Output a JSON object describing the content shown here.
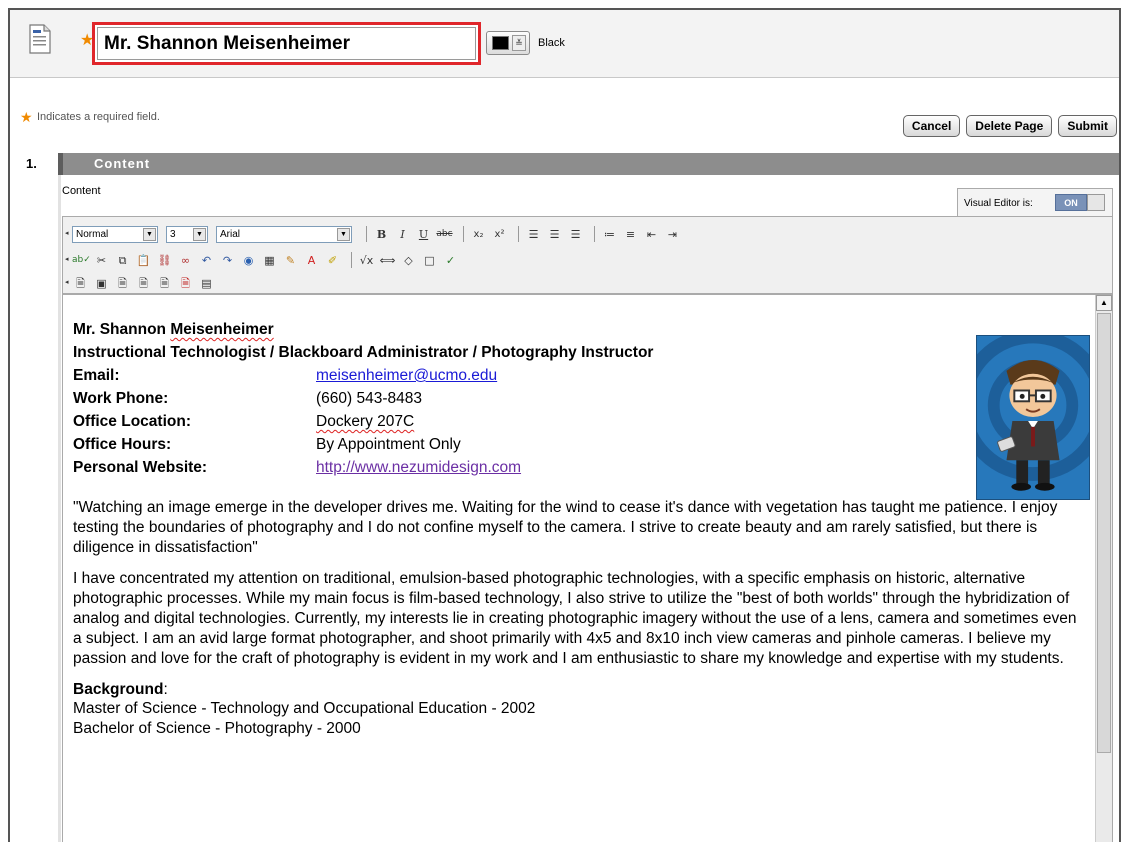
{
  "header": {
    "title_value": "Mr. Shannon Meisenheimer",
    "color_label": "Black",
    "color_value": "#000000"
  },
  "form": {
    "required_note": "Indicates a required field.",
    "buttons": {
      "cancel": "Cancel",
      "delete": "Delete Page",
      "submit": "Submit"
    }
  },
  "section": {
    "number": "1.",
    "title": "Content",
    "content_label": "Content"
  },
  "visual_editor": {
    "label": "Visual Editor is:",
    "state": "ON"
  },
  "toolbar": {
    "format": "Normal",
    "size": "3",
    "font": "Arial"
  },
  "document": {
    "name_first": "Mr. Shannon ",
    "name_last": "Meisenheimer",
    "position": "Instructional Technologist / Blackboard Administrator / Photography Instructor",
    "info": [
      {
        "label": "Email:",
        "value": "meisenheimer@ucmo.edu"
      },
      {
        "label": "Work Phone:",
        "value": "(660) 543-8483"
      },
      {
        "label": "Office Location:",
        "value": "Dockery 207C"
      },
      {
        "label": "Office Hours:",
        "value": "By Appointment Only"
      },
      {
        "label": "Personal Website:",
        "value": "http://www.nezumidesign.com"
      }
    ],
    "quote": "\"Watching an image emerge in the developer drives me. Waiting for the wind to cease it's dance with vegetation has taught me patience. I enjoy testing the boundaries of photography and I do not confine myself to the camera. I strive to create beauty and am rarely satisfied, but there is diligence in dissatisfaction\"",
    "bio": "I have concentrated my attention on traditional, emulsion-based photographic technologies, with a specific emphasis on historic, alternative photographic processes. While my main focus is film-based technology, I also strive to utilize the \"best of both worlds\" through the hybridization of analog and digital technologies. Currently, my interests lie in creating photographic imagery without the use of a lens, camera and sometimes even a subject. I am an avid large format photographer, and shoot primarily with 4x5 and 8x10 inch view cameras and pinhole cameras. I believe my passion and love for the craft of photography is evident in my work and I am enthusiastic to share my knowledge and expertise with my students.",
    "background_title": "Background",
    "background_colon": ":",
    "background": [
      "Master of Science - Technology and Occupational Education - 2002",
      "Bachelor of Science - Photography - 2000"
    ]
  },
  "colors": {
    "required_star": "#f08a00",
    "highlight_border": "#e0262b",
    "section_bar": "#8d8d8d",
    "link": "#1a1ad6"
  },
  "icons": [
    "page-icon",
    "required-star-icon",
    "chevron-down-icon",
    "avatar-image"
  ]
}
